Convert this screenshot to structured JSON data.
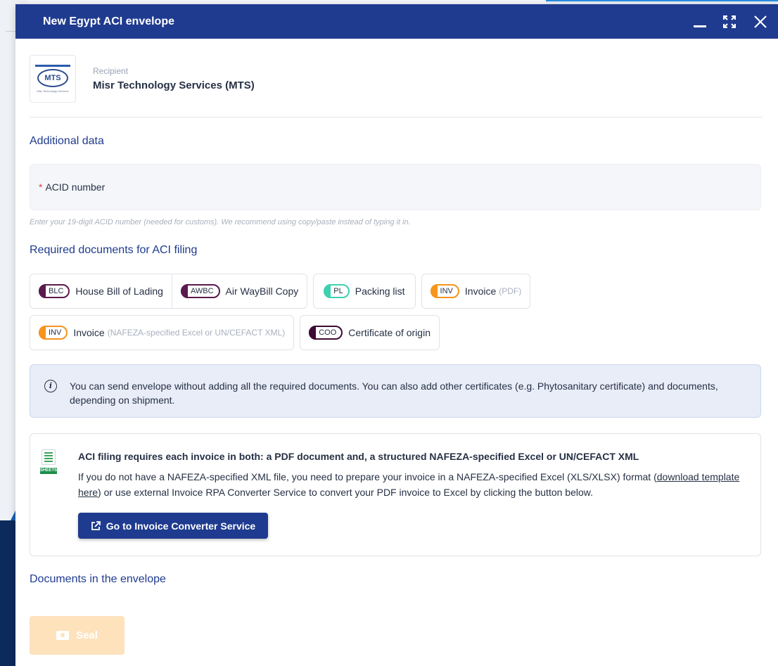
{
  "window": {
    "title": "New Egypt ACI envelope"
  },
  "recipient": {
    "label": "Recipient",
    "name": "Misr Technology Services (MTS)",
    "logo_text": "MTS",
    "logo_caption": "Misr Technology Services"
  },
  "additional": {
    "title": "Additional data",
    "acid_required_mark": "*",
    "acid_label": "ACID number",
    "acid_hint": "Enter your 19-digit ACID number (needed for customs). We recommend using copy/paste instead of typing it in."
  },
  "required_docs": {
    "title": "Required documents for ACI filing",
    "row1": [
      {
        "badge": "BLC",
        "label": "House Bill of Lading",
        "sub": "",
        "color": "#5a1a4f"
      },
      {
        "badge": "AWBC",
        "label": "Air WayBill Copy",
        "sub": "",
        "color": "#5a1a4f"
      },
      {
        "badge": "PL",
        "label": "Packing list",
        "sub": "",
        "color": "#3ed1b0"
      },
      {
        "badge": "INV",
        "label": "Invoice",
        "sub": "(PDF)",
        "color": "#f7941d"
      }
    ],
    "row2": [
      {
        "badge": "INV",
        "label": "Invoice",
        "sub": "(NAFEZA-specified Excel or UN/CEFACT XML)",
        "color": "#f7941d"
      },
      {
        "badge": "COO",
        "label": "Certificate of origin",
        "sub": "",
        "color": "#3d0b34"
      }
    ]
  },
  "info": {
    "icon": "i",
    "text": "You can send envelope without adding all the required documents. You can also add other certificates (e.g. Phytosanitary certificate) and documents, depending on shipment."
  },
  "aci": {
    "sheets_label": "SHEETS",
    "heading": "ACI filing requires each invoice in both: a PDF document and, a structured NAFEZA-specified Excel or UN/CEFACT XML",
    "body_before": "If you do not have a NAFEZA-specified XML file, you need to prepare your invoice in a NAFEZA-specified Excel (XLS/XLSX) format (",
    "link": "download template here",
    "body_after": ") or use external Invoice RPA Converter Service to convert your PDF invoice to Excel by clicking the button below.",
    "button": "Go to Invoice Converter Service"
  },
  "documents": {
    "title": "Documents in the envelope"
  },
  "actions": {
    "seal": "Seal"
  },
  "background": {
    "letter": "b"
  },
  "colors": {
    "primary": "#1f3b8f",
    "required": "#e0443c",
    "seal_disabled": "#fde2bc"
  }
}
